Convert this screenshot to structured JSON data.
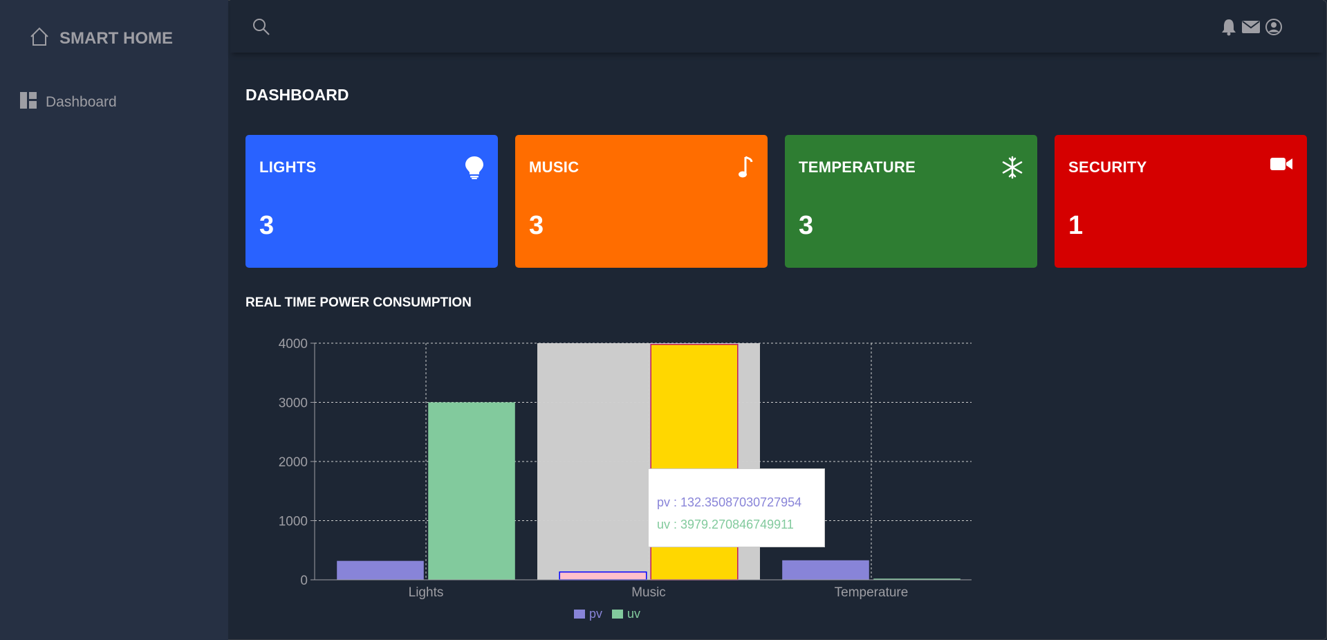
{
  "sidebar": {
    "brand": "SMART HOME",
    "items": [
      {
        "label": "Dashboard",
        "icon": "dashboard-icon"
      }
    ]
  },
  "topbar": {
    "icons": [
      "search-icon",
      "bell-icon",
      "envelope-icon",
      "user-circle-icon"
    ]
  },
  "page": {
    "title": "DASHBOARD"
  },
  "cards": [
    {
      "title": "LIGHTS",
      "value": "3",
      "icon": "lightbulb-icon",
      "color": "#2962ff"
    },
    {
      "title": "MUSIC",
      "value": "3",
      "icon": "music-note-icon",
      "color": "#ff6d00"
    },
    {
      "title": "TEMPERATURE",
      "value": "3",
      "icon": "snowflake-icon",
      "color": "#2e7d32"
    },
    {
      "title": "SECURITY",
      "value": "1",
      "icon": "video-camera-icon",
      "color": "#d50000"
    }
  ],
  "section": {
    "title": "REAL TIME POWER CONSUMPTION"
  },
  "chart_data": {
    "type": "bar",
    "categories": [
      "Lights",
      "Music",
      "Temperature"
    ],
    "series": [
      {
        "name": "pv",
        "values": [
          320,
          132.35087030727954,
          330
        ],
        "color": "#8884d8"
      },
      {
        "name": "uv",
        "values": [
          3000,
          3979.270846749911,
          20
        ],
        "color": "#82ca9d"
      }
    ],
    "ylim": [
      0,
      4000
    ],
    "yticks": [
      "0",
      "1000",
      "2000",
      "3000",
      "4000"
    ],
    "grid": true,
    "active_category": "Music",
    "highlight_colors": {
      "pv": "#ffc0cb",
      "uv": "#ffd700"
    },
    "legend_position": "bottom"
  },
  "tooltip": {
    "pv": "pv : 132.35087030727954",
    "uv": "uv : 3979.270846749911"
  }
}
